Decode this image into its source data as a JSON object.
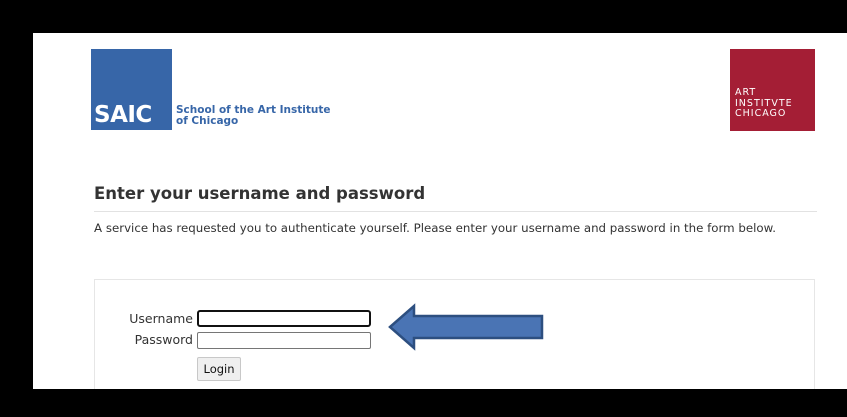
{
  "header": {
    "saic_logo": {
      "letters": "SAIC",
      "name_line1": "School of the Art Institute",
      "name_line2": "of Chicago"
    },
    "aic_logo": {
      "line1": "ART",
      "line2": "INSTITVTE",
      "line3": "CHICAGO"
    }
  },
  "main": {
    "heading": "Enter your username and password",
    "intro": "A service has requested you to authenticate yourself. Please enter your username and password in the form below."
  },
  "form": {
    "username_label": "Username",
    "username_value": "",
    "password_label": "Password",
    "password_value": "",
    "login_label": "Login"
  },
  "annotation": {
    "icon": "left-arrow-icon"
  },
  "colors": {
    "saic_blue": "#3766a8",
    "aic_red": "#a41e35",
    "arrow_fill": "#4a74b4",
    "arrow_stroke": "#2d4f80",
    "frame": "#000000",
    "page": "#ffffff"
  }
}
